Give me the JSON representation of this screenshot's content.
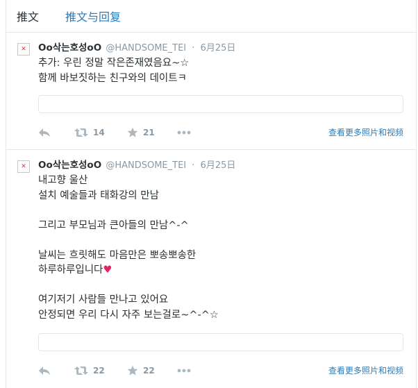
{
  "tabs": {
    "tweets": "推文",
    "tweets_and_replies": "推文与回复"
  },
  "tweets": [
    {
      "fullname": "Oo삭는호성oO",
      "username": "@HANDSOME_TEI",
      "date": "6月25日",
      "lines": [
        "추가: 우린 정말 작은존재였음요~☆",
        "함께 바보짓하는 친구와의 데이트ㅋ"
      ],
      "retweets": "14",
      "favorites": "21",
      "more_link": "查看更多照片和视频"
    },
    {
      "fullname": "Oo삭는호성oO",
      "username": "@HANDSOME_TEI",
      "date": "6月25日",
      "lines": [
        "내고향 울산",
        "설치 예술들과 태화강의 만남",
        "",
        "그리고 부모님과 큰아들의 만남^-^",
        "",
        "날씨는 흐릿해도 마음만은 뽀송뽀송한",
        "하루하루입니다",
        "",
        "여기저기 사람들 만나고 있어요",
        "안정되면 우리 다시 자주 보는걸로~^-^☆"
      ],
      "heart": "♥",
      "retweets": "22",
      "favorites": "22",
      "more_link": "查看更多照片和视频"
    }
  ],
  "icons": {
    "avatar_broken": "✕",
    "reply": "reply-icon",
    "retweet": "retweet-icon",
    "favorite": "star-icon",
    "more": "ellipsis-icon"
  },
  "colors": {
    "link": "#2b7bb9",
    "muted": "#8899a6",
    "icon": "#aab8c2",
    "heart": "#e0245e"
  }
}
